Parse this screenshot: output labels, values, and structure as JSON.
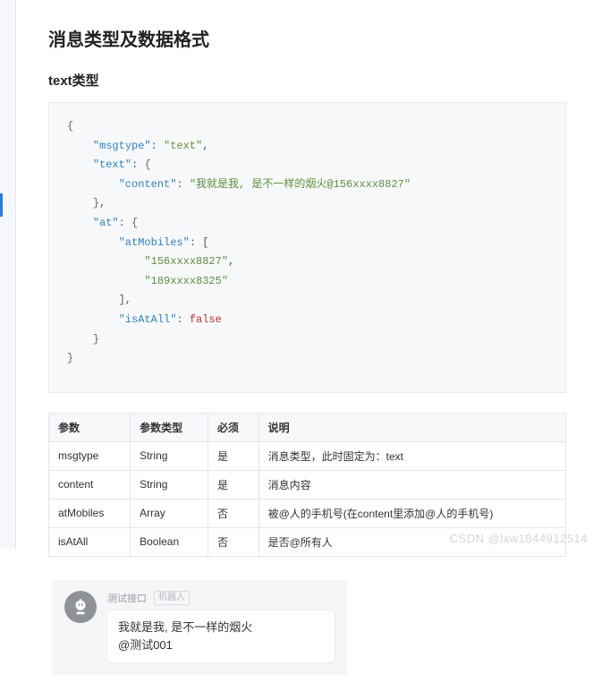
{
  "headings": {
    "main": "消息类型及数据格式",
    "section": "text类型"
  },
  "code": {
    "key_msgtype": "\"msgtype\"",
    "val_msgtype": "\"text\"",
    "key_text": "\"text\"",
    "key_content": "\"content\"",
    "val_content": "\"我就是我, 是不一样的烟火@156xxxx8827\"",
    "key_at": "\"at\"",
    "key_atMobiles": "\"atMobiles\"",
    "val_mob1": "\"156xxxx8827\"",
    "val_mob2": "\"189xxxx8325\"",
    "key_isAtAll": "\"isAtAll\"",
    "val_isAtAll": "false"
  },
  "table": {
    "head": {
      "c1": "参数",
      "c2": "参数类型",
      "c3": "必须",
      "c4": "说明"
    },
    "rows": [
      {
        "c1": "msgtype",
        "c2": "String",
        "c3": "是",
        "c4": "消息类型，此时固定为：text"
      },
      {
        "c1": "content",
        "c2": "String",
        "c3": "是",
        "c4": "消息内容"
      },
      {
        "c1": "atMobiles",
        "c2": "Array",
        "c3": "否",
        "c4": "被@人的手机号(在content里添加@人的手机号)"
      },
      {
        "c1": "isAtAll",
        "c2": "Boolean",
        "c3": "否",
        "c4": "是否@所有人"
      }
    ]
  },
  "chat": {
    "sender": "测试接口",
    "tag": "机器人",
    "line1": "我就是我, 是不一样的烟火",
    "line2": "@测试001"
  },
  "watermark": "CSDN @lxw1844912514"
}
